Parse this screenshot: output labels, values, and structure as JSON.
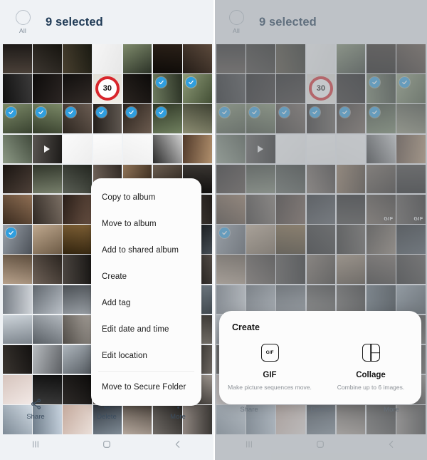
{
  "header": {
    "all_label": "All",
    "selected_text": "9 selected",
    "checkbox_icon": "circle-unchecked-icon",
    "title_color": "#1f3a55"
  },
  "toolbar": {
    "items": [
      {
        "label": "Share",
        "icon": "share-icon"
      },
      {
        "label": "Delete",
        "icon": "trash-icon"
      },
      {
        "label": "More",
        "icon": "more-vertical-icon"
      }
    ]
  },
  "navbar": {
    "items": [
      {
        "name": "recents-button",
        "icon": "recents-icon"
      },
      {
        "name": "home-button",
        "icon": "home-icon"
      },
      {
        "name": "back-button",
        "icon": "back-icon"
      }
    ]
  },
  "menu": {
    "items": [
      {
        "label": "Copy to album",
        "divider_before": false
      },
      {
        "label": "Move to album",
        "divider_before": false
      },
      {
        "label": "Add to shared album",
        "divider_before": false
      },
      {
        "label": "Create",
        "divider_before": false
      },
      {
        "label": "Add tag",
        "divider_before": false
      },
      {
        "label": "Edit date and time",
        "divider_before": false
      },
      {
        "label": "Edit location",
        "divider_before": false
      },
      {
        "label": "Move to Secure Folder",
        "divider_before": true
      }
    ]
  },
  "create_sheet": {
    "title": "Create",
    "options": [
      {
        "icon": "gif-icon",
        "icon_text": "GIF",
        "name": "GIF",
        "desc": "Make picture sequences move."
      },
      {
        "icon": "collage-icon",
        "icon_text": "",
        "name": "Collage",
        "desc": "Combine up to 6 images."
      }
    ]
  },
  "gallery": {
    "columns": 7,
    "selection_color": "#2f9ede",
    "badge_gif_label": "GIF",
    "sign_label": "30",
    "cells": [
      {
        "c1": "#4a4038",
        "c2": "#1d1a18",
        "sel": false
      },
      {
        "c1": "#3c3630",
        "c2": "#16140f",
        "sel": false
      },
      {
        "c1": "#49402f",
        "c2": "#1a1a12",
        "sel": false
      },
      {
        "c1": "#f6f6f6",
        "c2": "#e7e7e7",
        "sel": false,
        "sketch": true
      },
      {
        "c1": "#7e8a6b",
        "c2": "#2b3227",
        "sel": false
      },
      {
        "c1": "#2a2018",
        "c2": "#0e0b08",
        "sel": false
      },
      {
        "c1": "#5c4a3c",
        "c2": "#241c17",
        "sel": false
      },
      {
        "c1": "#3b3a3a",
        "c2": "#111111",
        "sel": false
      },
      {
        "c1": "#2b2523",
        "c2": "#0d0b0a",
        "sel": false
      },
      {
        "c1": "#332c28",
        "c2": "#100e0d",
        "sel": false
      },
      {
        "c1": "#f2efe9",
        "c2": "#e2ded6",
        "sel": false,
        "sign": true
      },
      {
        "c1": "#2a2420",
        "c2": "#0c0a09",
        "sel": false
      },
      {
        "c1": "#6d7a5e",
        "c2": "#2a3124",
        "sel": true
      },
      {
        "c1": "#8d9a77",
        "c2": "#434f35",
        "sel": true
      },
      {
        "c1": "#7c8a68",
        "c2": "#394230",
        "sel": true
      },
      {
        "c1": "#7a8866",
        "c2": "#353d2b",
        "sel": true
      },
      {
        "c1": "#6a5c52",
        "c2": "#2c251f",
        "sel": true
      },
      {
        "c1": "#5f5750",
        "c2": "#241f1b",
        "sel": true
      },
      {
        "c1": "#6b5b4f",
        "c2": "#2a221c",
        "sel": true
      },
      {
        "c1": "#70805f",
        "c2": "#2f3726",
        "sel": true
      },
      {
        "c1": "#8c8d72",
        "c2": "#3f4233",
        "sel": false
      },
      {
        "c1": "#8d9a86",
        "c2": "#414a3c",
        "sel": false
      },
      {
        "c1": "#585450",
        "c2": "#1d1b19",
        "sel": false,
        "play": true
      },
      {
        "c1": "#fbfbfb",
        "c2": "#ededed",
        "sel": false,
        "sketch": true
      },
      {
        "c1": "#fcfcfc",
        "c2": "#f0f0f0",
        "sel": false,
        "sketch": true
      },
      {
        "c1": "#fafafa",
        "c2": "#eeeeee",
        "sel": false,
        "sketch": true
      },
      {
        "c1": "#cfcfcf",
        "c2": "#2a2a2a",
        "sel": false
      },
      {
        "c1": "#b08f6c",
        "c2": "#50392a",
        "sel": false
      },
      {
        "c1": "#4d4038",
        "c2": "#191411",
        "sel": false
      },
      {
        "c1": "#777f6b",
        "c2": "#2f3429",
        "sel": false
      },
      {
        "c1": "#5a5f55",
        "c2": "#22251f",
        "sel": false
      },
      {
        "c1": "#7d6f64",
        "c2": "#2f2823",
        "sel": false
      },
      {
        "c1": "#8e7256",
        "c2": "#3b2d20",
        "sel": false
      },
      {
        "c1": "#6b5d50",
        "c2": "#28211b",
        "sel": false
      },
      {
        "c1": "#3a3632",
        "c2": "#131110",
        "sel": false
      },
      {
        "c1": "#8f6f54",
        "c2": "#3a2b1f",
        "sel": false
      },
      {
        "c1": "#7b6f64",
        "c2": "#2f2823",
        "sel": false
      },
      {
        "c1": "#6a5244",
        "c2": "#281d17",
        "sel": false
      },
      {
        "c1": "#52555a",
        "c2": "#1d1f22",
        "sel": false
      },
      {
        "c1": "#3e3a36",
        "c2": "#141211",
        "sel": false
      },
      {
        "c1": "#6e5f52",
        "c2": "#2a231d",
        "sel": false
      },
      {
        "c1": "#58504a",
        "c2": "#201c19",
        "sel": false
      },
      {
        "c1": "#9aa2ab",
        "c2": "#4c5158",
        "sel": true
      },
      {
        "c1": "#c0a98f",
        "c2": "#6d5b46",
        "sel": false
      },
      {
        "c1": "#7d5f35",
        "c2": "#33250f",
        "sel": false
      },
      {
        "c1": "#3d3a37",
        "c2": "#141312",
        "sel": false
      },
      {
        "c1": "#5d564f",
        "c2": "#221f1b",
        "sel": false
      },
      {
        "c1": "#8b7b6b",
        "c2": "#342d26",
        "sel": false
      },
      {
        "c1": "#454d54",
        "c2": "#171a1d",
        "sel": false
      },
      {
        "c1": "#b7a18b",
        "c2": "#5c4c3c",
        "sel": false
      },
      {
        "c1": "#6f6258",
        "c2": "#2a241f",
        "sel": false
      },
      {
        "c1": "#4b4540",
        "c2": "#1a1816",
        "sel": false
      },
      {
        "c1": "#7a6b5d",
        "c2": "#2e2720",
        "sel": false
      },
      {
        "c1": "#a08a72",
        "c2": "#453728",
        "sel": false
      },
      {
        "c1": "#6c5e54",
        "c2": "#28231e",
        "sel": false
      },
      {
        "c1": "#514a45",
        "c2": "#1c1a18",
        "sel": false
      },
      {
        "c1": "#cfd3d8",
        "c2": "#767d85",
        "sel": false
      },
      {
        "c1": "#b9bfc6",
        "c2": "#5f666d",
        "sel": false
      },
      {
        "c1": "#9aa0a6",
        "c2": "#4a4f54",
        "sel": false
      },
      {
        "c1": "#7e7a74",
        "c2": "#2f2c29",
        "sel": false
      },
      {
        "c1": "#6a655f",
        "c2": "#272421",
        "sel": false
      },
      {
        "c1": "#5f6b74",
        "c2": "#252c31",
        "sel": false
      },
      {
        "c1": "#8e9aa4",
        "c2": "#3f474d",
        "sel": false
      },
      {
        "c1": "#cdd4da",
        "c2": "#7c848c",
        "sel": false
      },
      {
        "c1": "#b2b8be",
        "c2": "#585e64",
        "sel": false
      },
      {
        "c1": "#a9a39c",
        "c2": "#4f4b46",
        "sel": false
      },
      {
        "c1": "#6f6a64",
        "c2": "#2a2724",
        "sel": false
      },
      {
        "c1": "#55504b",
        "c2": "#1f1d1a",
        "sel": false
      },
      {
        "c1": "#7a7view",
        "c2": "#2b2825",
        "sel": false
      },
      {
        "c1": "#8d8880",
        "c2": "#3c3935",
        "sel": false
      },
      {
        "c1": "#3a3530",
        "c2": "#131110",
        "sel": false
      },
      {
        "c1": "#b8bcc0",
        "c2": "#5c5f63",
        "sel": false
      },
      {
        "c1": "#aeb6bd",
        "c2": "#555b61",
        "sel": false
      },
      {
        "c1": "#5e5a56",
        "c2": "#222019",
        "sel": false
      },
      {
        "c1": "#7f776f",
        "c2": "#2f2c28",
        "sel": false
      },
      {
        "c1": "#a5988a",
        "c2": "#463f37",
        "sel": false
      },
      {
        "c1": "#6d6761",
        "c2": "#272522",
        "sel": false
      },
      {
        "c1": "#f2e9e6",
        "c2": "#d6c4bd",
        "sel": false
      },
      {
        "c1": "#3a3a3a",
        "c2": "#101010",
        "sel": false
      },
      {
        "c1": "#2e2a28",
        "c2": "#0d0c0b",
        "sel": false
      },
      {
        "c1": "#6b6360",
        "c2": "#272422",
        "sel": false
      },
      {
        "c1": "#8a7f78",
        "c2": "#34302c",
        "sel": false
      },
      {
        "c1": "#55504c",
        "c2": "#1e1c1a",
        "sel": false
      },
      {
        "c1": "#9b938c",
        "c2": "#423e3a",
        "sel": false
      },
      {
        "c1": "#cfd9e2",
        "c2": "#7d8a96",
        "sel": false
      },
      {
        "c1": "#c6d2de",
        "c2": "#6f7d8a",
        "sel": false
      },
      {
        "c1": "#eadfd9",
        "c2": "#c4a99c",
        "sel": false
      },
      {
        "c1": "#7f8b95",
        "c2": "#303740",
        "sel": false
      },
      {
        "c1": "#b3a69b",
        "c2": "#4e463f",
        "sel": false
      },
      {
        "c1": "#6f6a65",
        "c2": "#282624",
        "sel": false
      },
      {
        "c1": "#8f8680",
        "c2": "#3a3734",
        "sel": false
      }
    ]
  }
}
